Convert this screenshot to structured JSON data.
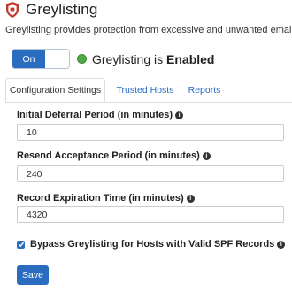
{
  "header": {
    "title": "Greylisting",
    "description": "Greylisting provides protection from excessive and unwanted email."
  },
  "toggle": {
    "on_label": "On",
    "state": "on"
  },
  "status": {
    "prefix": "Greylisting is ",
    "value": "Enabled",
    "indicator_color": "#51a846"
  },
  "tabs": [
    {
      "label": "Configuration Settings",
      "active": true
    },
    {
      "label": "Trusted Hosts",
      "active": false
    },
    {
      "label": "Reports",
      "active": false
    }
  ],
  "fields": [
    {
      "label": "Initial Deferral Period (in minutes)",
      "value": "10",
      "icon": "info-icon"
    },
    {
      "label": "Resend Acceptance Period (in minutes)",
      "value": "240",
      "icon": "info-icon"
    },
    {
      "label": "Record Expiration Time (in minutes)",
      "value": "4320",
      "icon": "info-icon"
    }
  ],
  "bypass": {
    "label": "Bypass Greylisting for Hosts with Valid SPF Records",
    "checked": true,
    "icon": "info-icon"
  },
  "save_label": "Save",
  "colors": {
    "accent": "#2a6cc0",
    "shield": "#c0392b"
  }
}
